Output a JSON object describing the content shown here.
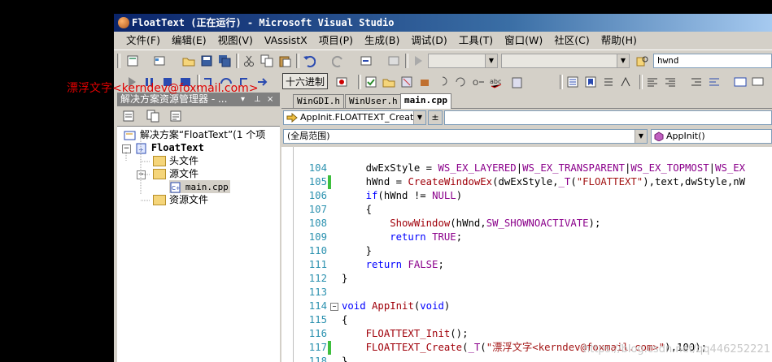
{
  "window": {
    "title": "FloatText (正在运行) - Microsoft Visual Studio"
  },
  "menu": [
    "文件(F)",
    "编辑(E)",
    "视图(V)",
    "VAssistX",
    "项目(P)",
    "生成(B)",
    "调试(D)",
    "工具(T)",
    "窗口(W)",
    "社区(C)",
    "帮助(H)"
  ],
  "toolbar": {
    "find_text": "hwnd",
    "hex_button": "十六进制"
  },
  "overlay_text": "漂浮文字<kerndev@foxmail.com>",
  "solution_explorer": {
    "title": "解决方案资源管理器 - ...",
    "pin_glyph": "ꟷ ×",
    "tree": [
      {
        "label": "解决方案“FloatText”(1 个项",
        "kind": "solution"
      },
      {
        "label": "FloatText",
        "kind": "project"
      },
      {
        "label": "头文件",
        "kind": "folder"
      },
      {
        "label": "源文件",
        "kind": "folder"
      },
      {
        "label": "main.cpp",
        "kind": "file"
      },
      {
        "label": "资源文件",
        "kind": "folder"
      }
    ]
  },
  "editor": {
    "tabs": [
      "WinGDI.h",
      "WinUser.h",
      "main.cpp"
    ],
    "active_tab": "main.cpp",
    "nav_function": "AppInit.FLOATTEXT_Create",
    "scope": "(全局范围)",
    "member": "AppInit()",
    "lines": [
      {
        "num": "104",
        "mark": "none",
        "segs": [
          [
            "nm",
            "    dwExStyle = "
          ],
          [
            "mc",
            "WS_EX_LAYERED"
          ],
          [
            "nm",
            "|"
          ],
          [
            "mc",
            "WS_EX_TRANSPARENT"
          ],
          [
            "nm",
            "|"
          ],
          [
            "mc",
            "WS_EX_TOPMOST"
          ],
          [
            "nm",
            "|"
          ],
          [
            "mc",
            "WS_EX"
          ]
        ]
      },
      {
        "num": "105",
        "mark": "green",
        "segs": [
          [
            "nm",
            "    hWnd = "
          ],
          [
            "fn",
            "CreateWindowEx"
          ],
          [
            "nm",
            "(dwExStyle,"
          ],
          [
            "mc",
            "_T"
          ],
          [
            "nm",
            "("
          ],
          [
            "str",
            "\"FLOATTEXT\""
          ],
          [
            "nm",
            "),text,dwStyle,nW"
          ]
        ]
      },
      {
        "num": "106",
        "mark": "none",
        "segs": [
          [
            "kw",
            "    if"
          ],
          [
            "nm",
            "(hWnd != "
          ],
          [
            "mc",
            "NULL"
          ],
          [
            "nm",
            ")"
          ]
        ]
      },
      {
        "num": "107",
        "mark": "none",
        "segs": [
          [
            "nm",
            "    {"
          ]
        ]
      },
      {
        "num": "108",
        "mark": "none",
        "segs": [
          [
            "fn",
            "        ShowWindow"
          ],
          [
            "nm",
            "(hWnd,"
          ],
          [
            "mc",
            "SW_SHOWNOACTIVATE"
          ],
          [
            "nm",
            ");"
          ]
        ]
      },
      {
        "num": "109",
        "mark": "none",
        "segs": [
          [
            "kw",
            "        return "
          ],
          [
            "mc",
            "TRUE"
          ],
          [
            "nm",
            ";"
          ]
        ]
      },
      {
        "num": "110",
        "mark": "none",
        "segs": [
          [
            "nm",
            "    }"
          ]
        ]
      },
      {
        "num": "111",
        "mark": "none",
        "segs": [
          [
            "kw",
            "    return "
          ],
          [
            "mc",
            "FALSE"
          ],
          [
            "nm",
            ";"
          ]
        ]
      },
      {
        "num": "112",
        "mark": "none",
        "segs": [
          [
            "nm",
            "}"
          ]
        ]
      },
      {
        "num": "113",
        "mark": "none",
        "segs": []
      },
      {
        "num": "114",
        "mark": "none",
        "fold": "⊟",
        "segs": [
          [
            "kw",
            "void "
          ],
          [
            "fn",
            "AppInit"
          ],
          [
            "nm",
            "("
          ],
          [
            "kw",
            "void"
          ],
          [
            "nm",
            ")"
          ]
        ]
      },
      {
        "num": "115",
        "mark": "none",
        "segs": [
          [
            "nm",
            "{"
          ]
        ]
      },
      {
        "num": "116",
        "mark": "none",
        "segs": [
          [
            "fn",
            "    FLOATTEXT_Init"
          ],
          [
            "nm",
            "();"
          ]
        ]
      },
      {
        "num": "117",
        "mark": "green",
        "segs": [
          [
            "fn",
            "    FLOATTEXT_Create"
          ],
          [
            "nm",
            "("
          ],
          [
            "mc",
            "_T"
          ],
          [
            "nm",
            "("
          ],
          [
            "str",
            "\"漂浮文字<kerndev@foxmail.com>\""
          ],
          [
            "nm",
            "),100);"
          ]
        ]
      },
      {
        "num": "118",
        "mark": "none",
        "segs": [
          [
            "nm",
            "}"
          ]
        ]
      }
    ]
  },
  "watermark": "https://blog.csdn.net/qq446252221",
  "colors": {
    "keyword": "#0000ff",
    "macro": "#8b008b",
    "function": "#a0000a",
    "string": "#a31515",
    "line_number": "#2b91af",
    "overlay": "#e00000"
  }
}
